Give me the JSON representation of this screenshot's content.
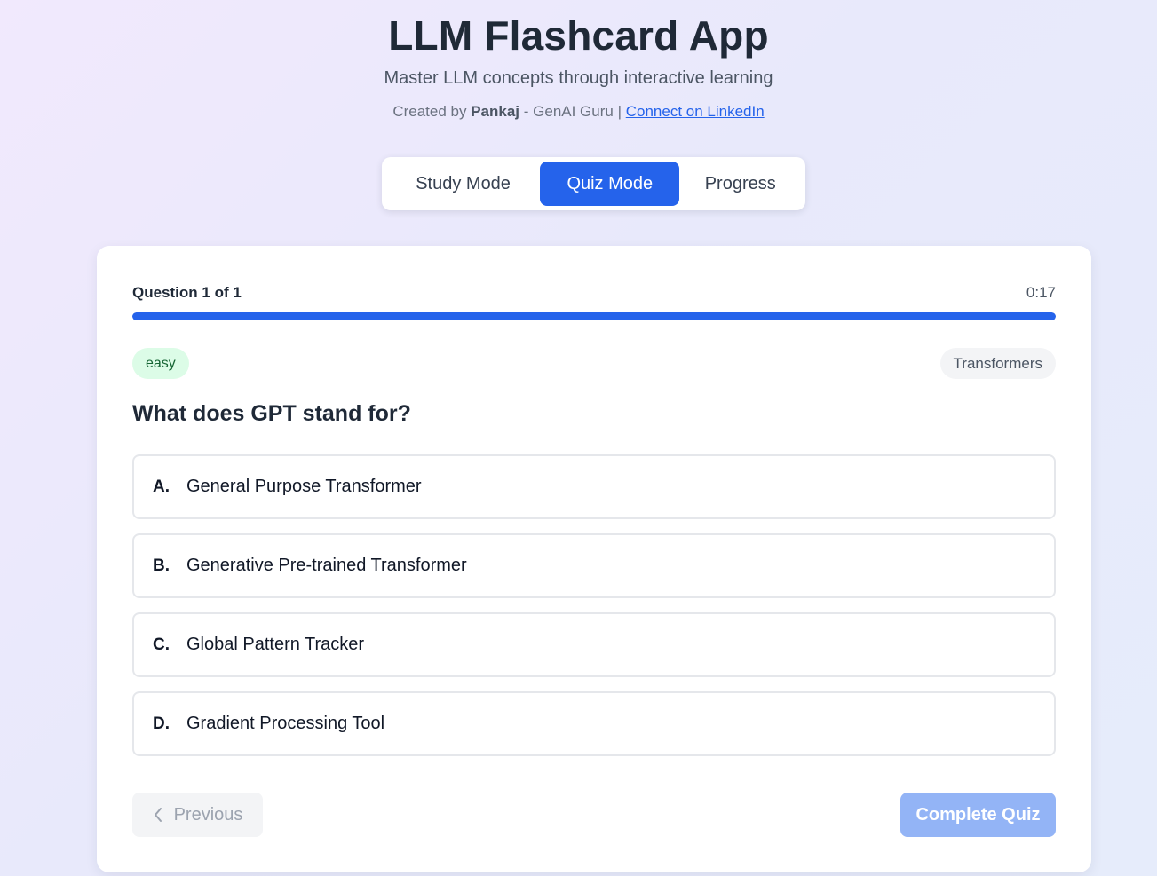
{
  "header": {
    "title": "LLM Flashcard App",
    "subtitle": "Master LLM concepts through interactive learning",
    "credits_prefix": "Created by ",
    "author": "Pankaj",
    "credits_middle": " - GenAI Guru | ",
    "linkedin_label": "Connect on LinkedIn"
  },
  "tabs": [
    {
      "label": "Study Mode",
      "active": false
    },
    {
      "label": "Quiz Mode",
      "active": true
    },
    {
      "label": "Progress",
      "active": false
    }
  ],
  "quiz": {
    "counter": "Question 1 of 1",
    "timer": "0:17",
    "progress_percent": 100,
    "difficulty": "easy",
    "topic": "Transformers",
    "question": "What does GPT stand for?",
    "options": [
      {
        "letter": "A.",
        "text": "General Purpose Transformer"
      },
      {
        "letter": "B.",
        "text": "Generative Pre-trained Transformer"
      },
      {
        "letter": "C.",
        "text": "Global Pattern Tracker"
      },
      {
        "letter": "D.",
        "text": "Gradient Processing Tool"
      }
    ],
    "previous_label": "Previous",
    "complete_label": "Complete Quiz"
  },
  "colors": {
    "accent": "#2563eb",
    "easy_badge_bg": "#dcfce7",
    "easy_badge_text": "#166534"
  }
}
